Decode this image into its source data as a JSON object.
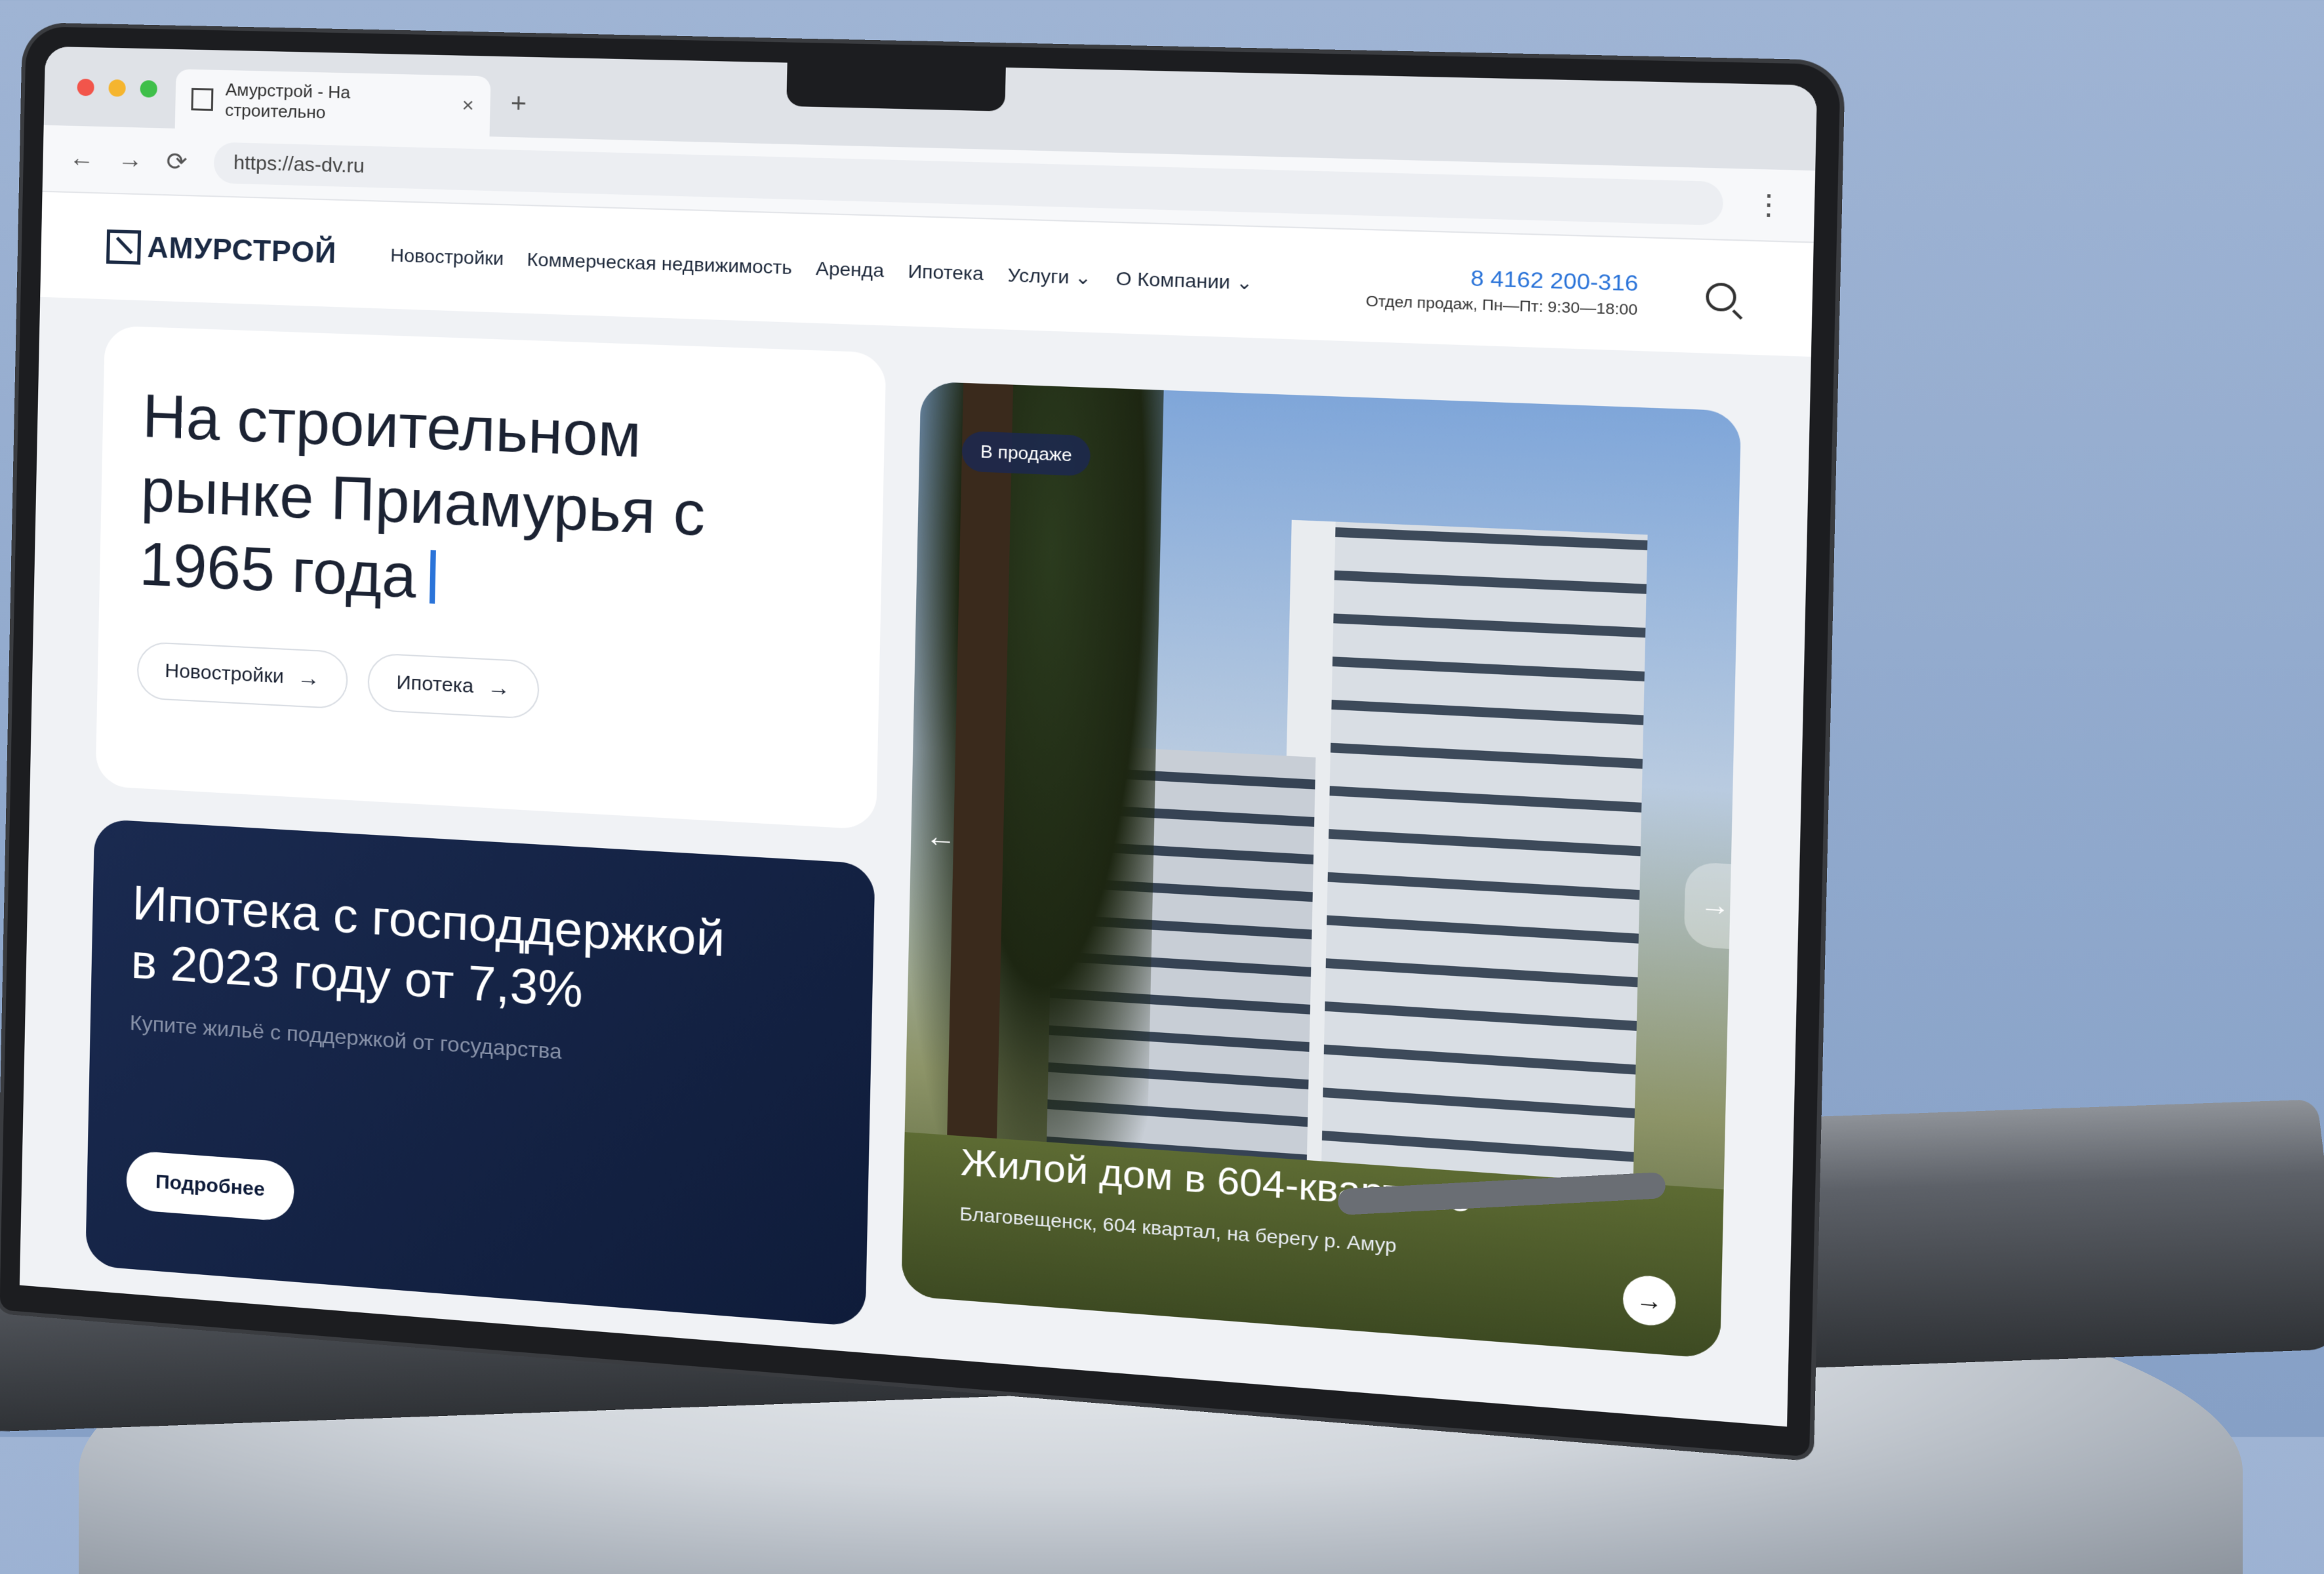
{
  "browser": {
    "tab_title": "Амурстрой - На строительно",
    "tab_close": "×",
    "new_tab": "+",
    "url": "https://as-dv.ru",
    "nav_back": "←",
    "nav_forward": "→",
    "nav_reload": "⟳",
    "menu": "⋮"
  },
  "site": {
    "logo": "АМУРСТРОЙ",
    "nav": [
      "Новостройки",
      "Коммерческая недвижимость",
      "Аренда",
      "Ипотека",
      "Услуги ⌄",
      "О Компании ⌄"
    ],
    "phone": "8 4162 200-316",
    "hours": "Отдел продаж, Пн—Пт: 9:30—18:00"
  },
  "hero": {
    "title": "На строительном рынке Приамурья с 1965 года",
    "buttons": [
      "Новостройки",
      "Ипотека"
    ]
  },
  "promo": {
    "title": "Ипотека с господдержкой в 2023 году от 7,3%",
    "subtitle": "Купите жильё с поддержкой от государства",
    "button": "Подробнее"
  },
  "slide": {
    "badge": "В продаже",
    "title": "Жилой дом в 604-квартале",
    "subtitle": "Благовещенск, 604 квартал, на берегу р. Амур",
    "prev": "←",
    "next": "→",
    "go": "→"
  },
  "colors": {
    "accent": "#2b74d9",
    "dark_card": "#0f1c3a"
  }
}
